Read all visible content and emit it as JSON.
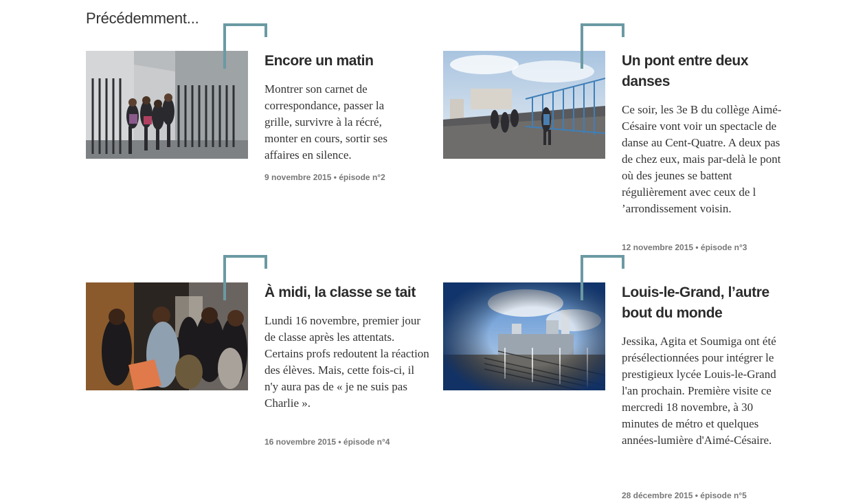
{
  "section": {
    "title": "Précédemment..."
  },
  "colors": {
    "accent": "#6b9aa3",
    "text": "#333333",
    "meta": "#777777"
  },
  "episodes": [
    {
      "title": "Encore un matin",
      "description": "Montrer son carnet de correspondance, passer la grille, survivre à la récré, monter en cours, sortir ses affaires en silence.",
      "meta": "9 novembre 2015 • épisode n°2"
    },
    {
      "title": "Un pont entre deux danses",
      "description": "Ce soir, les 3e B du collège Aimé-Césaire vont voir un spectacle de danse au Cent-Quatre. A deux pas de chez eux, mais par-delà le pont où des jeunes se battent régulièrement avec ceux de l ’arrondissement voisin.",
      "meta": "12 novembre 2015 • épisode n°3"
    },
    {
      "title": "À midi, la classe se tait",
      "description": "Lundi 16 novembre, premier jour de classe après les attentats. Certains profs redoutent la réaction des élèves. Mais, cette fois-ci, il n'y aura pas de « je ne suis pas Charlie ».",
      "meta": "16 novembre 2015 • épisode n°4"
    },
    {
      "title": "Louis-le-Grand, l’autre bout du monde",
      "description": "Jessika, Agita et Soumiga ont été présélectionnées pour intégrer le prestigieux lycée Louis-le-Grand l'an prochain. Première visite ce mercredi 18 novembre, à 30 minutes de métro et quelques années-lumière d'Aimé-Césaire.",
      "meta": "28 décembre 2015 • épisode n°5"
    }
  ]
}
